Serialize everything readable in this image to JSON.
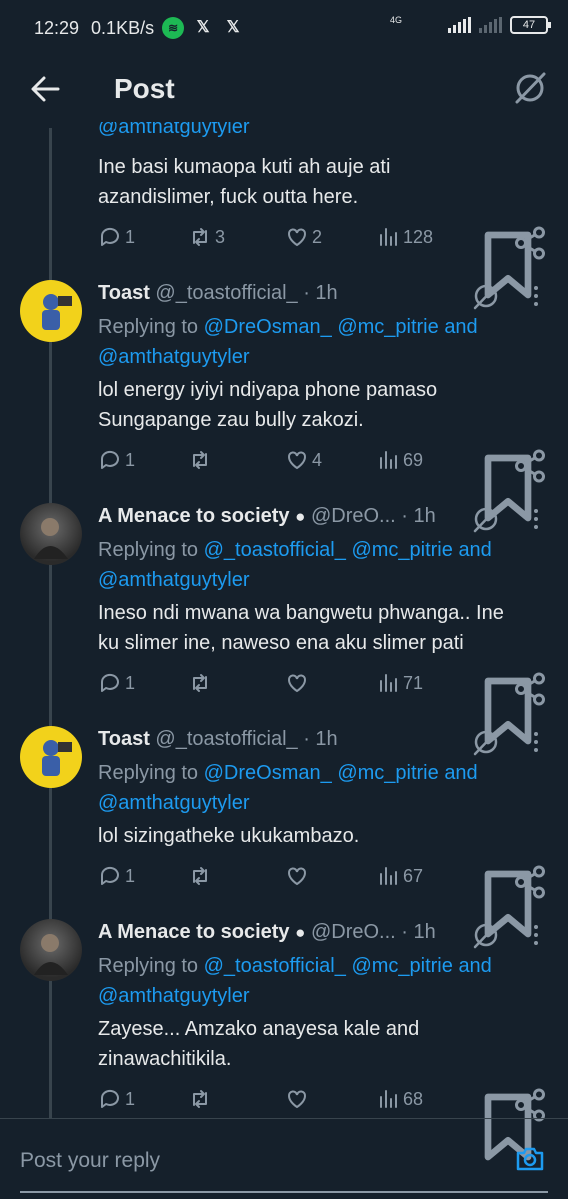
{
  "status_bar": {
    "time": "12:29",
    "speed": "0.1KB/s",
    "network": "4G",
    "battery": "47"
  },
  "header": {
    "title": "Post"
  },
  "top_fragment": {
    "mention": "@amthatguytyler",
    "text_line1": "Ine basi kumaopa kuti ah auje ati",
    "text_line2": "azandislimer, fuck outta here.",
    "replies": "1",
    "reposts": "3",
    "likes": "2",
    "views": "128"
  },
  "posts": [
    {
      "name": "Toast",
      "handle": "@_toastofficial_ · 1h",
      "replying_prefix": "Replying to",
      "mention1": "@DreOsman_",
      "mention2": "@mc_pitrie",
      "and_word": "and",
      "mention3": "@amthatguytyler",
      "text_line1": "lol energy iyiyi ndiyapa phone pamaso",
      "text_line2": "Sungapange zau bully zakozi.",
      "replies": "1",
      "reposts": "",
      "likes": "4",
      "views": "69"
    },
    {
      "name": "A Menace to society",
      "handle": "@DreO... · 1h",
      "replying_prefix": "Replying to",
      "mention1": "@_toastofficial_",
      "mention2": "@mc_pitrie",
      "and_word": "and",
      "mention3": "@amthatguytyler",
      "text_line1": "Ineso ndi mwana wa bangwetu phwanga.. Ine",
      "text_line2": "ku slimer ine, naweso ena aku slimer pati",
      "replies": "1",
      "reposts": "",
      "likes": "",
      "views": "71"
    },
    {
      "name": "Toast",
      "handle": "@_toastofficial_ · 1h",
      "replying_prefix": "Replying to",
      "mention1": "@DreOsman_",
      "mention2": "@mc_pitrie",
      "and_word": "and",
      "mention3": "@amthatguytyler",
      "text_line1": "lol sizingatheke ukukambazo.",
      "text_line2": "",
      "replies": "1",
      "reposts": "",
      "likes": "",
      "views": "67"
    },
    {
      "name": "A Menace to society",
      "handle": "@DreO... · 1h",
      "replying_prefix": "Replying to",
      "mention1": "@_toastofficial_",
      "mention2": "@mc_pitrie",
      "and_word": "and",
      "mention3": "@amthatguytyler",
      "text_line1": "Zayese... Amzako anayesa kale and",
      "text_line2": "zinawachitikila.",
      "replies": "1",
      "reposts": "",
      "likes": "",
      "views": "68"
    }
  ],
  "reply_bar": {
    "placeholder": "Post your reply"
  },
  "colors": {
    "background": "#15202b",
    "accent": "#1d9bf0",
    "muted": "#8b98a5"
  }
}
